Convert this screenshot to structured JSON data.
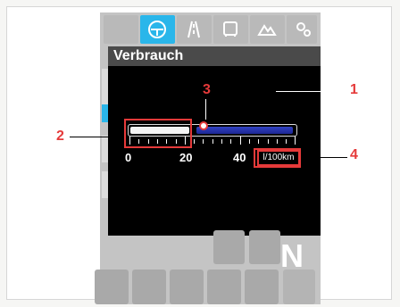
{
  "title": "Verbrauch",
  "tabs": [
    {
      "icon": "steering-wheel-icon",
      "active": true
    },
    {
      "icon": "road-icon",
      "active": false
    },
    {
      "icon": "bus-icon",
      "active": false
    },
    {
      "icon": "mountain-car-icon",
      "active": false
    },
    {
      "icon": "settings-gears-icon",
      "active": false
    }
  ],
  "gauge": {
    "value_current": 20,
    "scale_labels": [
      "0",
      "20",
      "40"
    ],
    "unit": "l/100km",
    "colors": {
      "bar_current": "#f4f4f4",
      "bar_remaining": "#2a35b0",
      "highlight": "#e53a3a"
    }
  },
  "gear": "N",
  "callouts": [
    "1",
    "2",
    "3",
    "4"
  ]
}
